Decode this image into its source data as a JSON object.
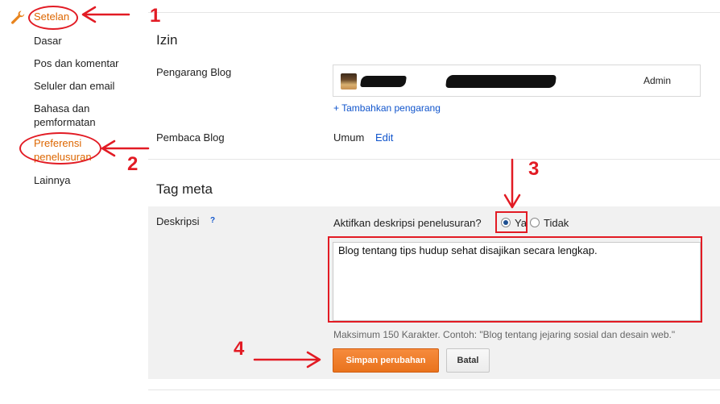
{
  "sidebar": {
    "settings_label": "Setelan",
    "items": [
      {
        "label": "Dasar"
      },
      {
        "label": "Pos dan komentar"
      },
      {
        "label": "Seluler dan email"
      },
      {
        "label": "Bahasa dan pemformatan"
      },
      {
        "label": "Preferensi penelusuran"
      },
      {
        "label": "Lainnya"
      }
    ]
  },
  "permissions": {
    "title": "Izin",
    "blog_authors_label": "Pengarang Blog",
    "author_role": "Admin",
    "add_author_link": "+ Tambahkan pengarang",
    "blog_readers_label": "Pembaca Blog",
    "readers_value": "Umum",
    "edit_link": "Edit"
  },
  "meta_tags": {
    "title": "Tag meta",
    "description_label": "Deskripsi",
    "help_glyph": "?",
    "enable_question": "Aktifkan deskripsi penelusuran?",
    "option_yes": "Ya",
    "option_no": "Tidak",
    "description_value": "Blog tentang tips hudup sehat disajikan secara lengkap.",
    "hint": "Maksimum 150 Karakter. Contoh: \"Blog tentang jejaring sosial dan desain web.\"",
    "save_button": "Simpan perubahan",
    "cancel_button": "Batal"
  },
  "annotations": {
    "n1": "1",
    "n2": "2",
    "n3": "3",
    "n4": "4",
    "color": "#e21b24"
  },
  "colors": {
    "accent_orange": "#dd6600",
    "link_blue": "#1155cc",
    "save_button": "#f07c2a"
  },
  "icons": {
    "settings": "wrench-icon"
  }
}
